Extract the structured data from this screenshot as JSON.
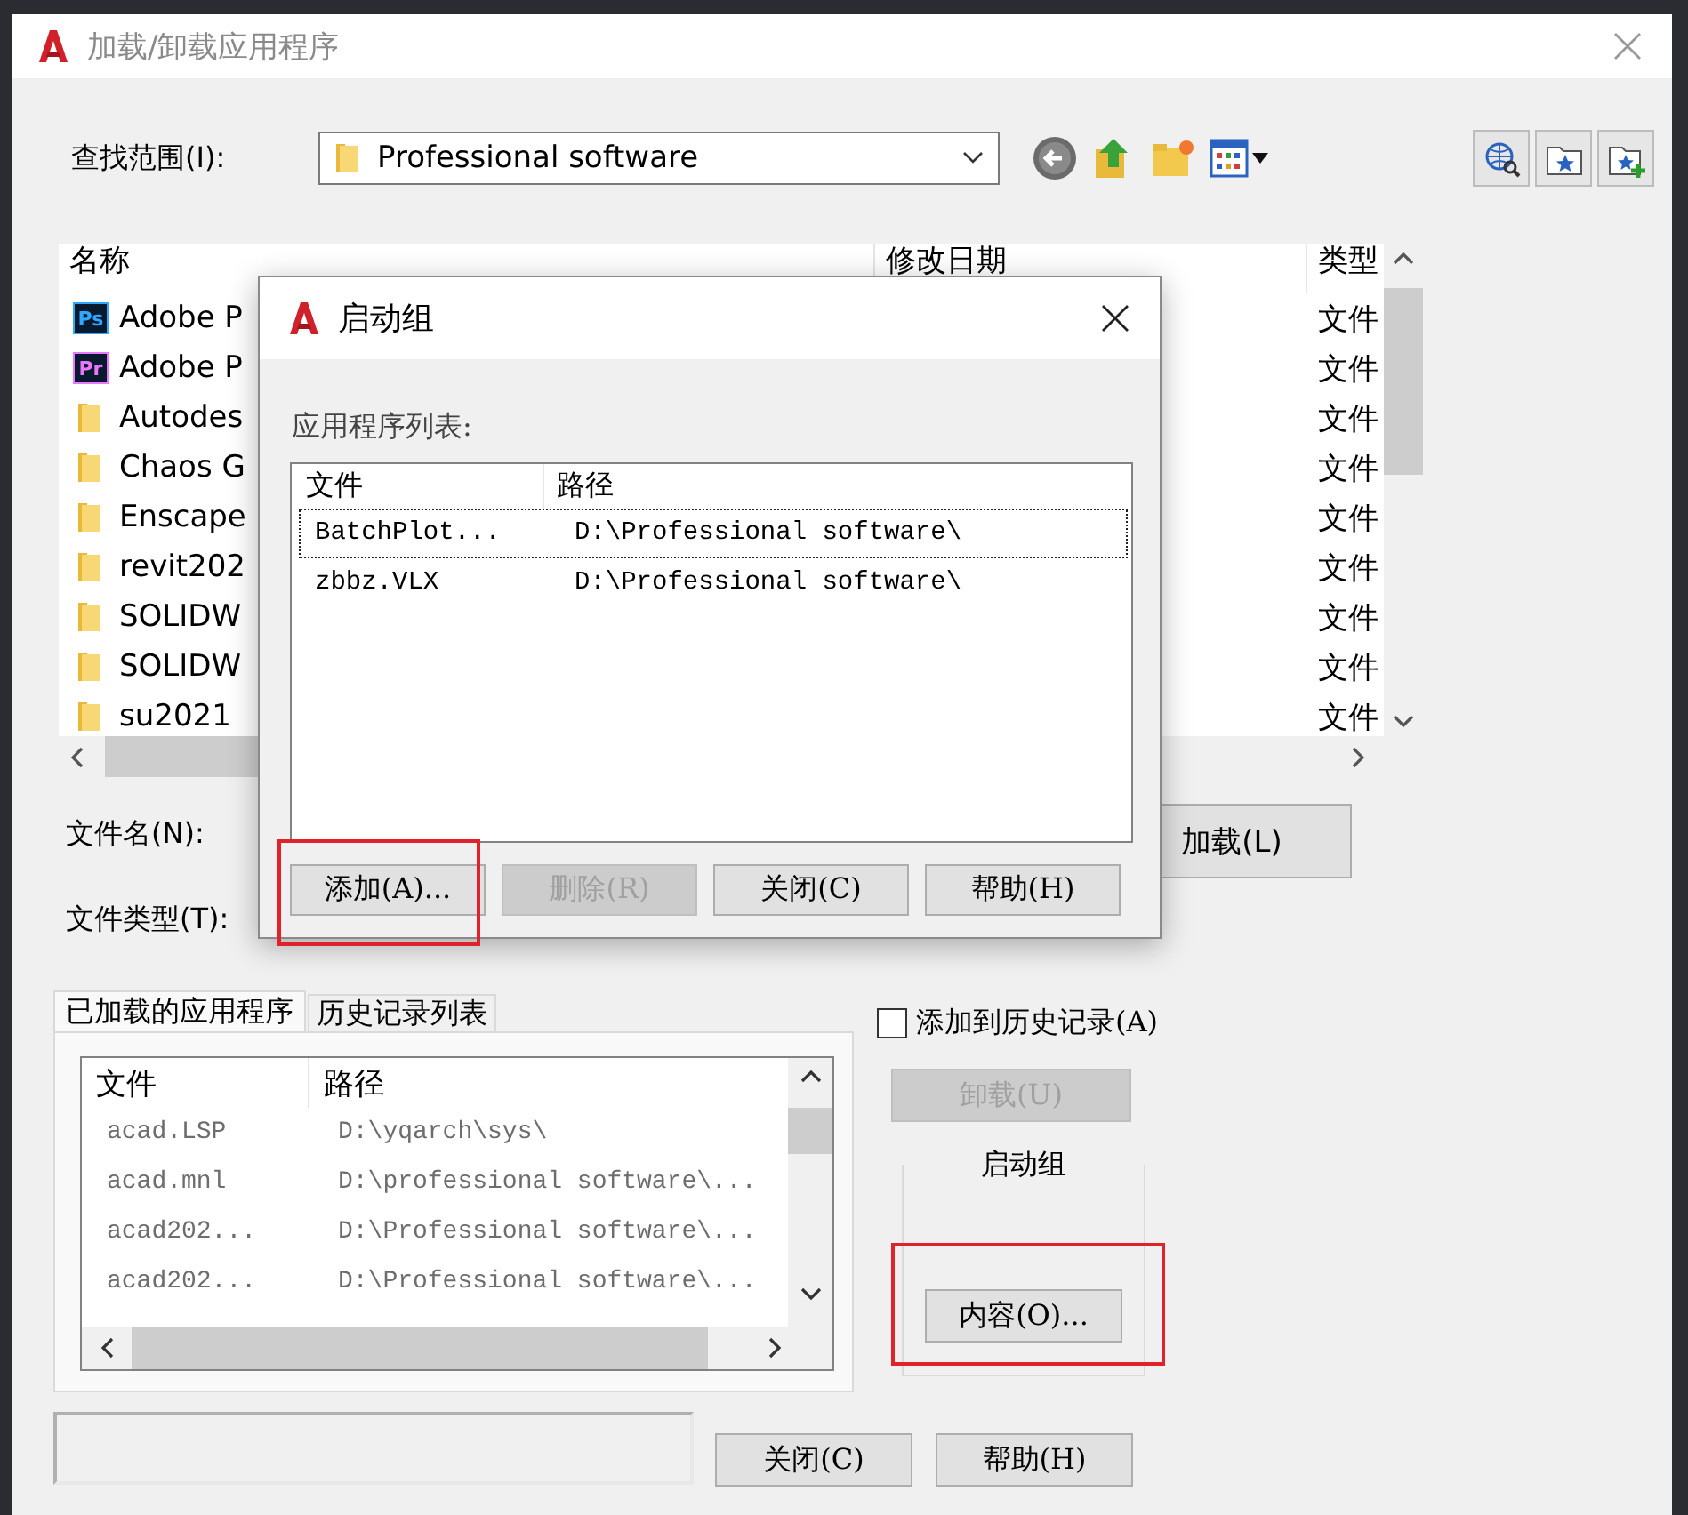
{
  "window": {
    "title": "加载/卸载应用程序"
  },
  "look_in": {
    "label": "查找范围(I):",
    "value": "Professional software"
  },
  "file_list": {
    "columns": [
      "名称",
      "修改日期",
      "类型"
    ],
    "rows": [
      {
        "kind": "app",
        "badge": "Ps",
        "color": "#31a8ff",
        "name": "Adobe P",
        "type": "文件"
      },
      {
        "kind": "app",
        "badge": "Pr",
        "color": "#ea77ff",
        "name": "Adobe P",
        "type": "文件"
      },
      {
        "kind": "folder",
        "name": "Autodes",
        "type": "文件"
      },
      {
        "kind": "folder",
        "name": "Chaos G",
        "type": "文件"
      },
      {
        "kind": "folder",
        "name": "Enscape",
        "type": "文件"
      },
      {
        "kind": "folder",
        "name": "revit202",
        "type": "文件"
      },
      {
        "kind": "folder",
        "name": "SOLIDW",
        "type": "文件"
      },
      {
        "kind": "folder",
        "name": "SOLIDW",
        "type": "文件"
      },
      {
        "kind": "folder",
        "name": "su2021",
        "type": "文件"
      }
    ]
  },
  "file_name": {
    "label": "文件名(N):"
  },
  "file_type": {
    "label": "文件类型(T):"
  },
  "load_button": {
    "label": "加载(L)",
    "disabled": false
  },
  "tabs": [
    {
      "label": "已加载的应用程序",
      "selected": true
    },
    {
      "label": "历史记录列表",
      "selected": false
    }
  ],
  "loaded_list": {
    "columns": [
      "文件",
      "路径"
    ],
    "rows": [
      {
        "file": "acad.LSP",
        "path": "D:\\yqarch\\sys\\"
      },
      {
        "file": "acad.mnl",
        "path": "D:\\professional software\\..."
      },
      {
        "file": "acad202...",
        "path": "D:\\Professional software\\..."
      },
      {
        "file": "acad202...",
        "path": "D:\\Professional software\\..."
      }
    ]
  },
  "add_to_history": {
    "label": "添加到历史记录(A)",
    "checked": false
  },
  "unload_button": {
    "label": "卸载(U)",
    "disabled": true
  },
  "startup_group": {
    "title": "启动组",
    "contents_button": {
      "label": "内容(O)...",
      "disabled": false,
      "highlighted": true
    }
  },
  "bottom_buttons": [
    {
      "label": "关闭(C)",
      "disabled": false
    },
    {
      "label": "帮助(H)",
      "disabled": false
    }
  ],
  "startup_dialog": {
    "title": "启动组",
    "list_label": "应用程序列表:",
    "columns": [
      "文件",
      "路径"
    ],
    "rows": [
      {
        "file": "BatchPlot...",
        "path": "D:\\Professional software\\",
        "selected": true
      },
      {
        "file": "zbbz.VLX",
        "path": "D:\\Professional software\\",
        "selected": false
      }
    ],
    "buttons": [
      {
        "label": "添加(A)...",
        "disabled": false,
        "highlighted": true
      },
      {
        "label": "删除(R)",
        "disabled": true,
        "highlighted": false
      },
      {
        "label": "关闭(C)",
        "disabled": false,
        "highlighted": false
      },
      {
        "label": "帮助(H)",
        "disabled": false,
        "highlighted": false
      }
    ]
  }
}
